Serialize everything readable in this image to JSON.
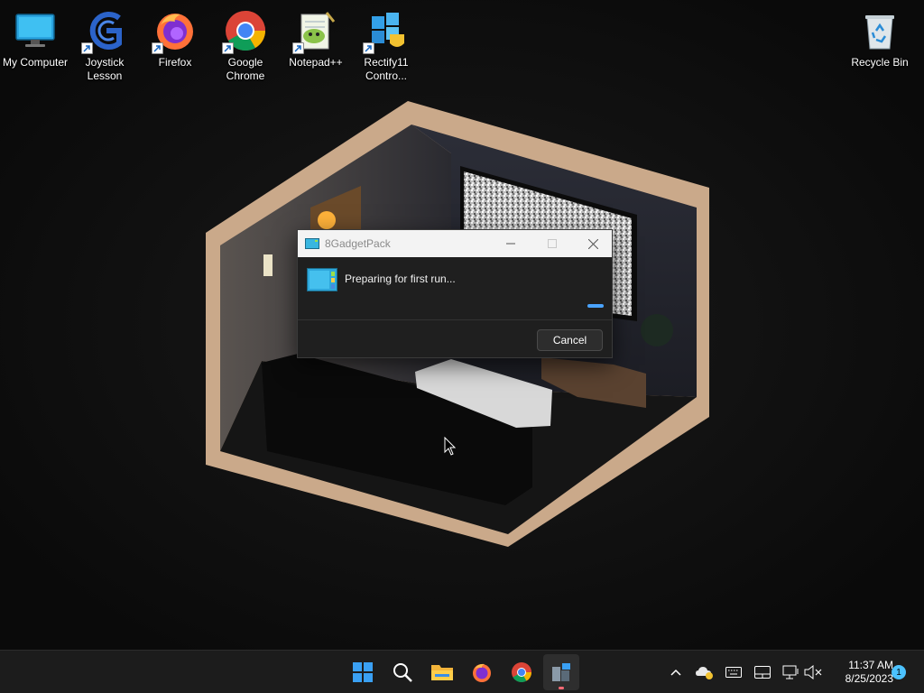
{
  "desktop": {
    "icons": [
      {
        "label": "My Computer",
        "icon": "monitor-icon",
        "shortcut": false
      },
      {
        "label": "Joystick Lesson",
        "icon": "joystick-app-icon",
        "shortcut": true
      },
      {
        "label": "Firefox",
        "icon": "firefox-icon",
        "shortcut": true
      },
      {
        "label": "Google Chrome",
        "icon": "chrome-icon",
        "shortcut": true
      },
      {
        "label": "Notepad++",
        "icon": "notepadpp-icon",
        "shortcut": true
      },
      {
        "label": "Rectify11 Contro...",
        "icon": "rectify11-icon",
        "shortcut": true
      },
      {
        "label": "Recycle Bin",
        "icon": "recycle-bin-icon",
        "shortcut": false
      }
    ]
  },
  "dialog": {
    "title": "8GadgetPack",
    "message": "Preparing for first run...",
    "cancel_label": "Cancel",
    "progress_color": "#4aa3ff"
  },
  "taskbar": {
    "pinned": [
      "windows-start-icon",
      "search-icon",
      "file-explorer-icon",
      "firefox-icon",
      "chrome-icon",
      "8gadgetpack-icon"
    ],
    "tray": [
      "chevron-up-icon",
      "onedrive-icon",
      "keyboard-icon",
      "touchpad-icon",
      "network-icon",
      "volume-muted-icon"
    ],
    "time": "11:37 AM",
    "date": "8/25/2023",
    "notification_count": "1"
  },
  "colors": {
    "accent": "#4cc2ff",
    "taskbar_bg": "#1c1c1c",
    "dialog_bg": "#1f1f1f",
    "active_indicator": "#ff6a75"
  }
}
